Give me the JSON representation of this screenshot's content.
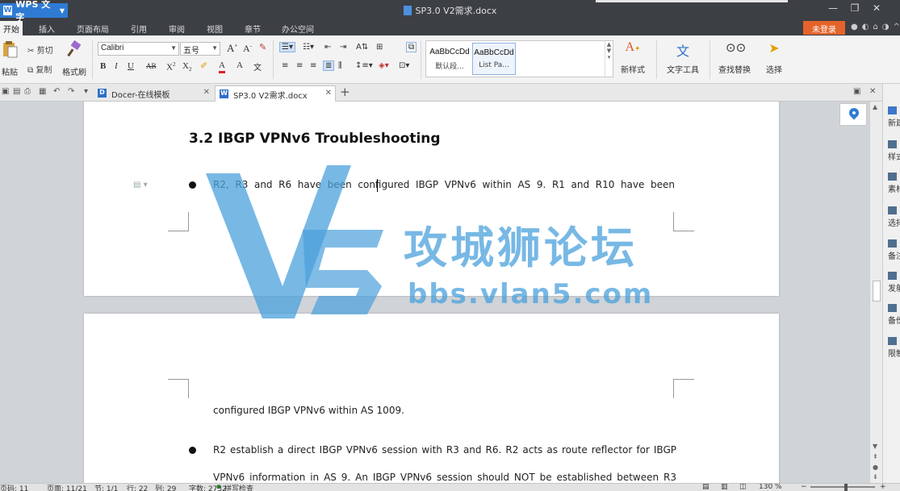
{
  "app": {
    "name": "WPS 文字",
    "doc_title": "SP3.0 V2需求.docx"
  },
  "menu": {
    "items": [
      "开始",
      "插入",
      "页面布局",
      "引用",
      "审阅",
      "视图",
      "章节",
      "办公空间"
    ],
    "login": "未登录"
  },
  "ribbon": {
    "paste": "粘贴",
    "cut": "剪切",
    "copy": "复制",
    "format_painter": "格式刷",
    "font_name": "Calibri",
    "font_size": "五号",
    "styles": [
      {
        "sample": "AaBbCcDd",
        "label": "默认段..."
      },
      {
        "sample": "AaBbCcDd",
        "label": "List Pa..."
      }
    ],
    "new_style": "新样式",
    "text_tools": "文字工具",
    "find_replace": "查找替换",
    "select": "选择"
  },
  "tabs": [
    {
      "label": "Docer-在线模板",
      "active": false
    },
    {
      "label": "SP3.0 V2需求.docx",
      "active": true
    }
  ],
  "document": {
    "heading": "3.2 IBGP VPNv6 Troubleshooting",
    "bullet1_line1": "R2, R3 and R6 have been configured IBGP VPNv6 within AS 9. R1 and R10 have been",
    "bullet1_line2": "configured IBGP VPNv6 within AS 1009.",
    "bullet2_line1": "R2 establish a direct IBGP VPNv6 session with R3 and R6. R2 acts as route reflector for IBGP",
    "bullet2_line2": "VPNv6 information in AS 9. An IBGP VPNv6 session should NOT be established between R3"
  },
  "watermark": {
    "cn": "攻城狮论坛",
    "url": "bbs.vlan5.com",
    "accent": "#4aa0dc"
  },
  "sidepanel": [
    "新建",
    "样式",
    "素材",
    "选择",
    "备注",
    "发射",
    "备份",
    "限制"
  ],
  "status": {
    "page_no": "页码: 11",
    "pages": "页面: 11/21",
    "section": "节: 1/1",
    "row": "行: 22",
    "col": "列: 29",
    "words": "字数: 2732",
    "spell": "拼写检查",
    "zoom": "130 %"
  }
}
